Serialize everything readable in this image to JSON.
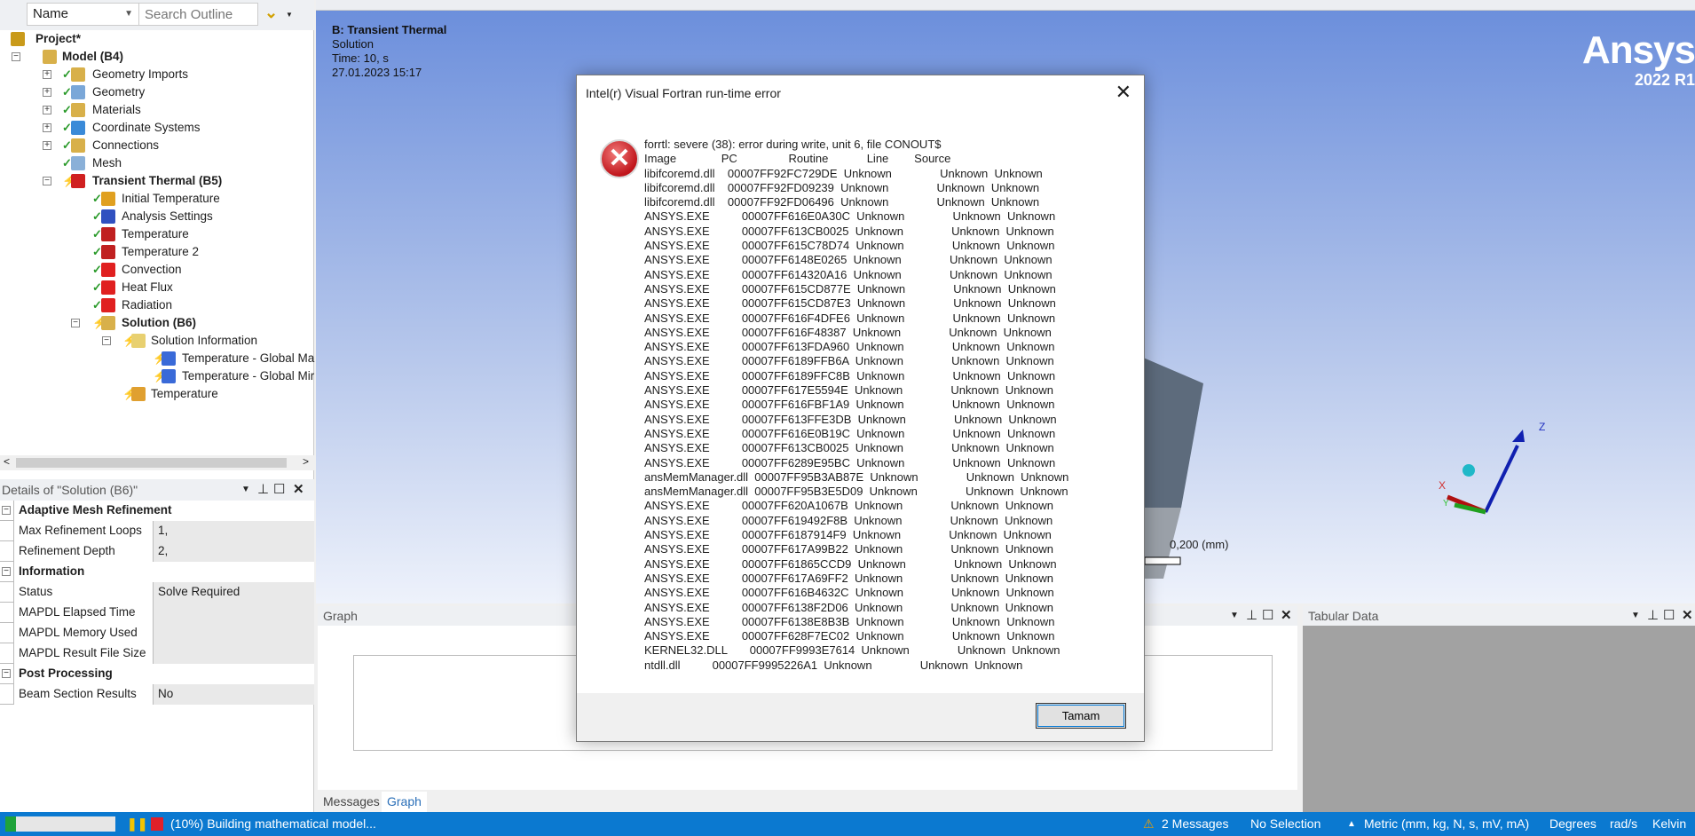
{
  "outline": {
    "filter_value": "Name",
    "search_placeholder": "Search Outline",
    "tree": [
      "Project*",
      "Model (B4)",
      "Geometry Imports",
      "Geometry",
      "Materials",
      "Coordinate Systems",
      "Connections",
      "Mesh",
      "Transient Thermal (B5)",
      "Initial Temperature",
      "Analysis Settings",
      "Temperature",
      "Temperature 2",
      "Convection",
      "Heat Flux",
      "Radiation",
      "Solution (B6)",
      "Solution Information",
      "Temperature - Global Ma",
      "Temperature - Global Mir",
      "Temperature"
    ]
  },
  "details": {
    "title": "Details of \"Solution (B6)\"",
    "groups": [
      {
        "name": "Adaptive Mesh Refinement",
        "rows": [
          [
            "Max Refinement Loops",
            "1,"
          ],
          [
            "Refinement Depth",
            "2,"
          ]
        ]
      },
      {
        "name": "Information",
        "rows": [
          [
            "Status",
            "Solve Required"
          ],
          [
            "MAPDL Elapsed Time",
            ""
          ],
          [
            "MAPDL Memory Used",
            ""
          ],
          [
            "MAPDL Result File Size",
            ""
          ]
        ]
      },
      {
        "name": "Post Processing",
        "rows": [
          [
            "Beam Section Results",
            "No"
          ]
        ]
      }
    ]
  },
  "viewport": {
    "title": "B: Transient Thermal",
    "subtitle": "Solution",
    "time": "Time: 10, s",
    "date": "27.01.2023 15:17",
    "logo": "Ansys",
    "version": "2022 R1",
    "scale": "0,200 (mm)",
    "axes": {
      "x": "X",
      "y": "Y",
      "z": "Z"
    }
  },
  "graph": {
    "title": "Graph"
  },
  "tabular": {
    "title": "Tabular Data"
  },
  "bottom_tabs": [
    "Messages",
    "Graph"
  ],
  "status": {
    "progress_percent": 10,
    "text": "(10%) Building mathematical model...",
    "messages": "2 Messages",
    "selection": "No Selection",
    "units": "Metric (mm, kg, N, s, mV, mA)",
    "angle": "Degrees",
    "rot": "rad/s",
    "temp": "Kelvin"
  },
  "dialog": {
    "title": "Intel(r) Visual Fortran run-time error",
    "ok_label": "Tamam",
    "lines": [
      "forrtl: severe (38): error during write, unit 6, file CONOUT$",
      "Image              PC                Routine            Line        Source",
      "libifcoremd.dll    00007FF92FC729DE  Unknown               Unknown  Unknown",
      "libifcoremd.dll    00007FF92FD09239  Unknown               Unknown  Unknown",
      "libifcoremd.dll    00007FF92FD06496  Unknown               Unknown  Unknown",
      "ANSYS.EXE          00007FF616E0A30C  Unknown               Unknown  Unknown",
      "ANSYS.EXE          00007FF613CB0025  Unknown               Unknown  Unknown",
      "ANSYS.EXE          00007FF615C78D74  Unknown               Unknown  Unknown",
      "ANSYS.EXE          00007FF6148E0265  Unknown               Unknown  Unknown",
      "ANSYS.EXE          00007FF614320A16  Unknown               Unknown  Unknown",
      "ANSYS.EXE          00007FF615CD877E  Unknown               Unknown  Unknown",
      "ANSYS.EXE          00007FF615CD87E3  Unknown               Unknown  Unknown",
      "ANSYS.EXE          00007FF616F4DFE6  Unknown               Unknown  Unknown",
      "ANSYS.EXE          00007FF616F48387  Unknown               Unknown  Unknown",
      "ANSYS.EXE          00007FF613FDA960  Unknown               Unknown  Unknown",
      "ANSYS.EXE          00007FF6189FFB6A  Unknown               Unknown  Unknown",
      "ANSYS.EXE          00007FF6189FFC8B  Unknown               Unknown  Unknown",
      "ANSYS.EXE          00007FF617E5594E  Unknown               Unknown  Unknown",
      "ANSYS.EXE          00007FF616FBF1A9  Unknown               Unknown  Unknown",
      "ANSYS.EXE          00007FF613FFE3DB  Unknown               Unknown  Unknown",
      "ANSYS.EXE          00007FF616E0B19C  Unknown               Unknown  Unknown",
      "ANSYS.EXE          00007FF613CB0025  Unknown               Unknown  Unknown",
      "ANSYS.EXE          00007FF6289E95BC  Unknown               Unknown  Unknown",
      "ansMemManager.dll  00007FF95B3AB87E  Unknown               Unknown  Unknown",
      "ansMemManager.dll  00007FF95B3E5D09  Unknown               Unknown  Unknown",
      "ANSYS.EXE          00007FF620A1067B  Unknown               Unknown  Unknown",
      "ANSYS.EXE          00007FF619492F8B  Unknown               Unknown  Unknown",
      "ANSYS.EXE          00007FF6187914F9  Unknown               Unknown  Unknown",
      "ANSYS.EXE          00007FF617A99B22  Unknown               Unknown  Unknown",
      "ANSYS.EXE          00007FF61865CCD9  Unknown               Unknown  Unknown",
      "ANSYS.EXE          00007FF617A69FF2  Unknown               Unknown  Unknown",
      "ANSYS.EXE          00007FF616B4632C  Unknown               Unknown  Unknown",
      "ANSYS.EXE          00007FF6138F2D06  Unknown               Unknown  Unknown",
      "ANSYS.EXE          00007FF6138E8B3B  Unknown               Unknown  Unknown",
      "ANSYS.EXE          00007FF628F7EC02  Unknown               Unknown  Unknown",
      "KERNEL32.DLL       00007FF9993E7614  Unknown               Unknown  Unknown",
      "ntdll.dll          00007FF9995226A1  Unknown               Unknown  Unknown"
    ]
  },
  "colors": {
    "accent": "#0b79d0",
    "check": "#2a9a2a",
    "error": "#c0151b"
  }
}
